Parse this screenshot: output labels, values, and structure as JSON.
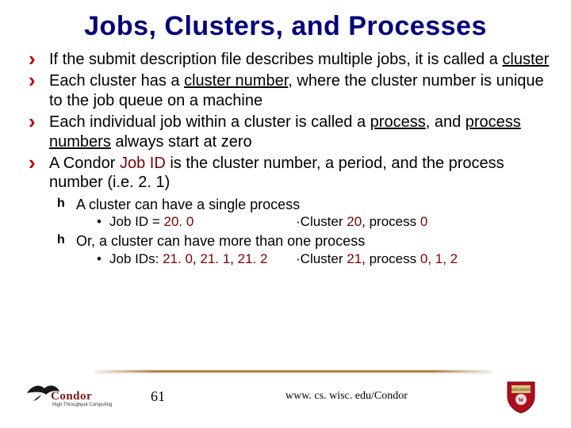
{
  "title": "Jobs, Clusters, and Processes",
  "b1": {
    "p1": "If the submit description file describes multiple jobs, it is called a ",
    "u1": "cluster"
  },
  "b2": {
    "p1": "Each cluster has a ",
    "u1": "cluster number",
    "p2": ", where the cluster number is unique to the job queue on a machine"
  },
  "b3": {
    "p1": "Each individual job within a cluster is called a ",
    "u1": "process",
    "p2": ", and ",
    "u2": "process numbers",
    "p3": " always start at zero"
  },
  "b4": {
    "p1": "A Condor ",
    "m1": "Job ID",
    "p2": " is the cluster number, a period, and the process number (i.e. 2. 1)"
  },
  "s1": "A cluster can have a single process",
  "s1a": {
    "l": "Job ID = ",
    "m1": "20. 0",
    "r1": "·Cluster ",
    "m2": "20",
    "r2": ", process ",
    "m3": "0"
  },
  "s2": "Or, a cluster can have more than one process",
  "s2a": {
    "l": "Job IDs: ",
    "m1": "21. 0",
    "c1": ", ",
    "m2": "21. 1",
    "c2": ", ",
    "m3": "21. 2",
    "r1": "·Cluster ",
    "m4": "21",
    "r2": ", process ",
    "m5": "0, 1, 2"
  },
  "footer": {
    "page": "61",
    "url": "www. cs. wisc. edu/Condor",
    "logo_text": "Condor",
    "logo_sub": "High Throughput Computing"
  }
}
